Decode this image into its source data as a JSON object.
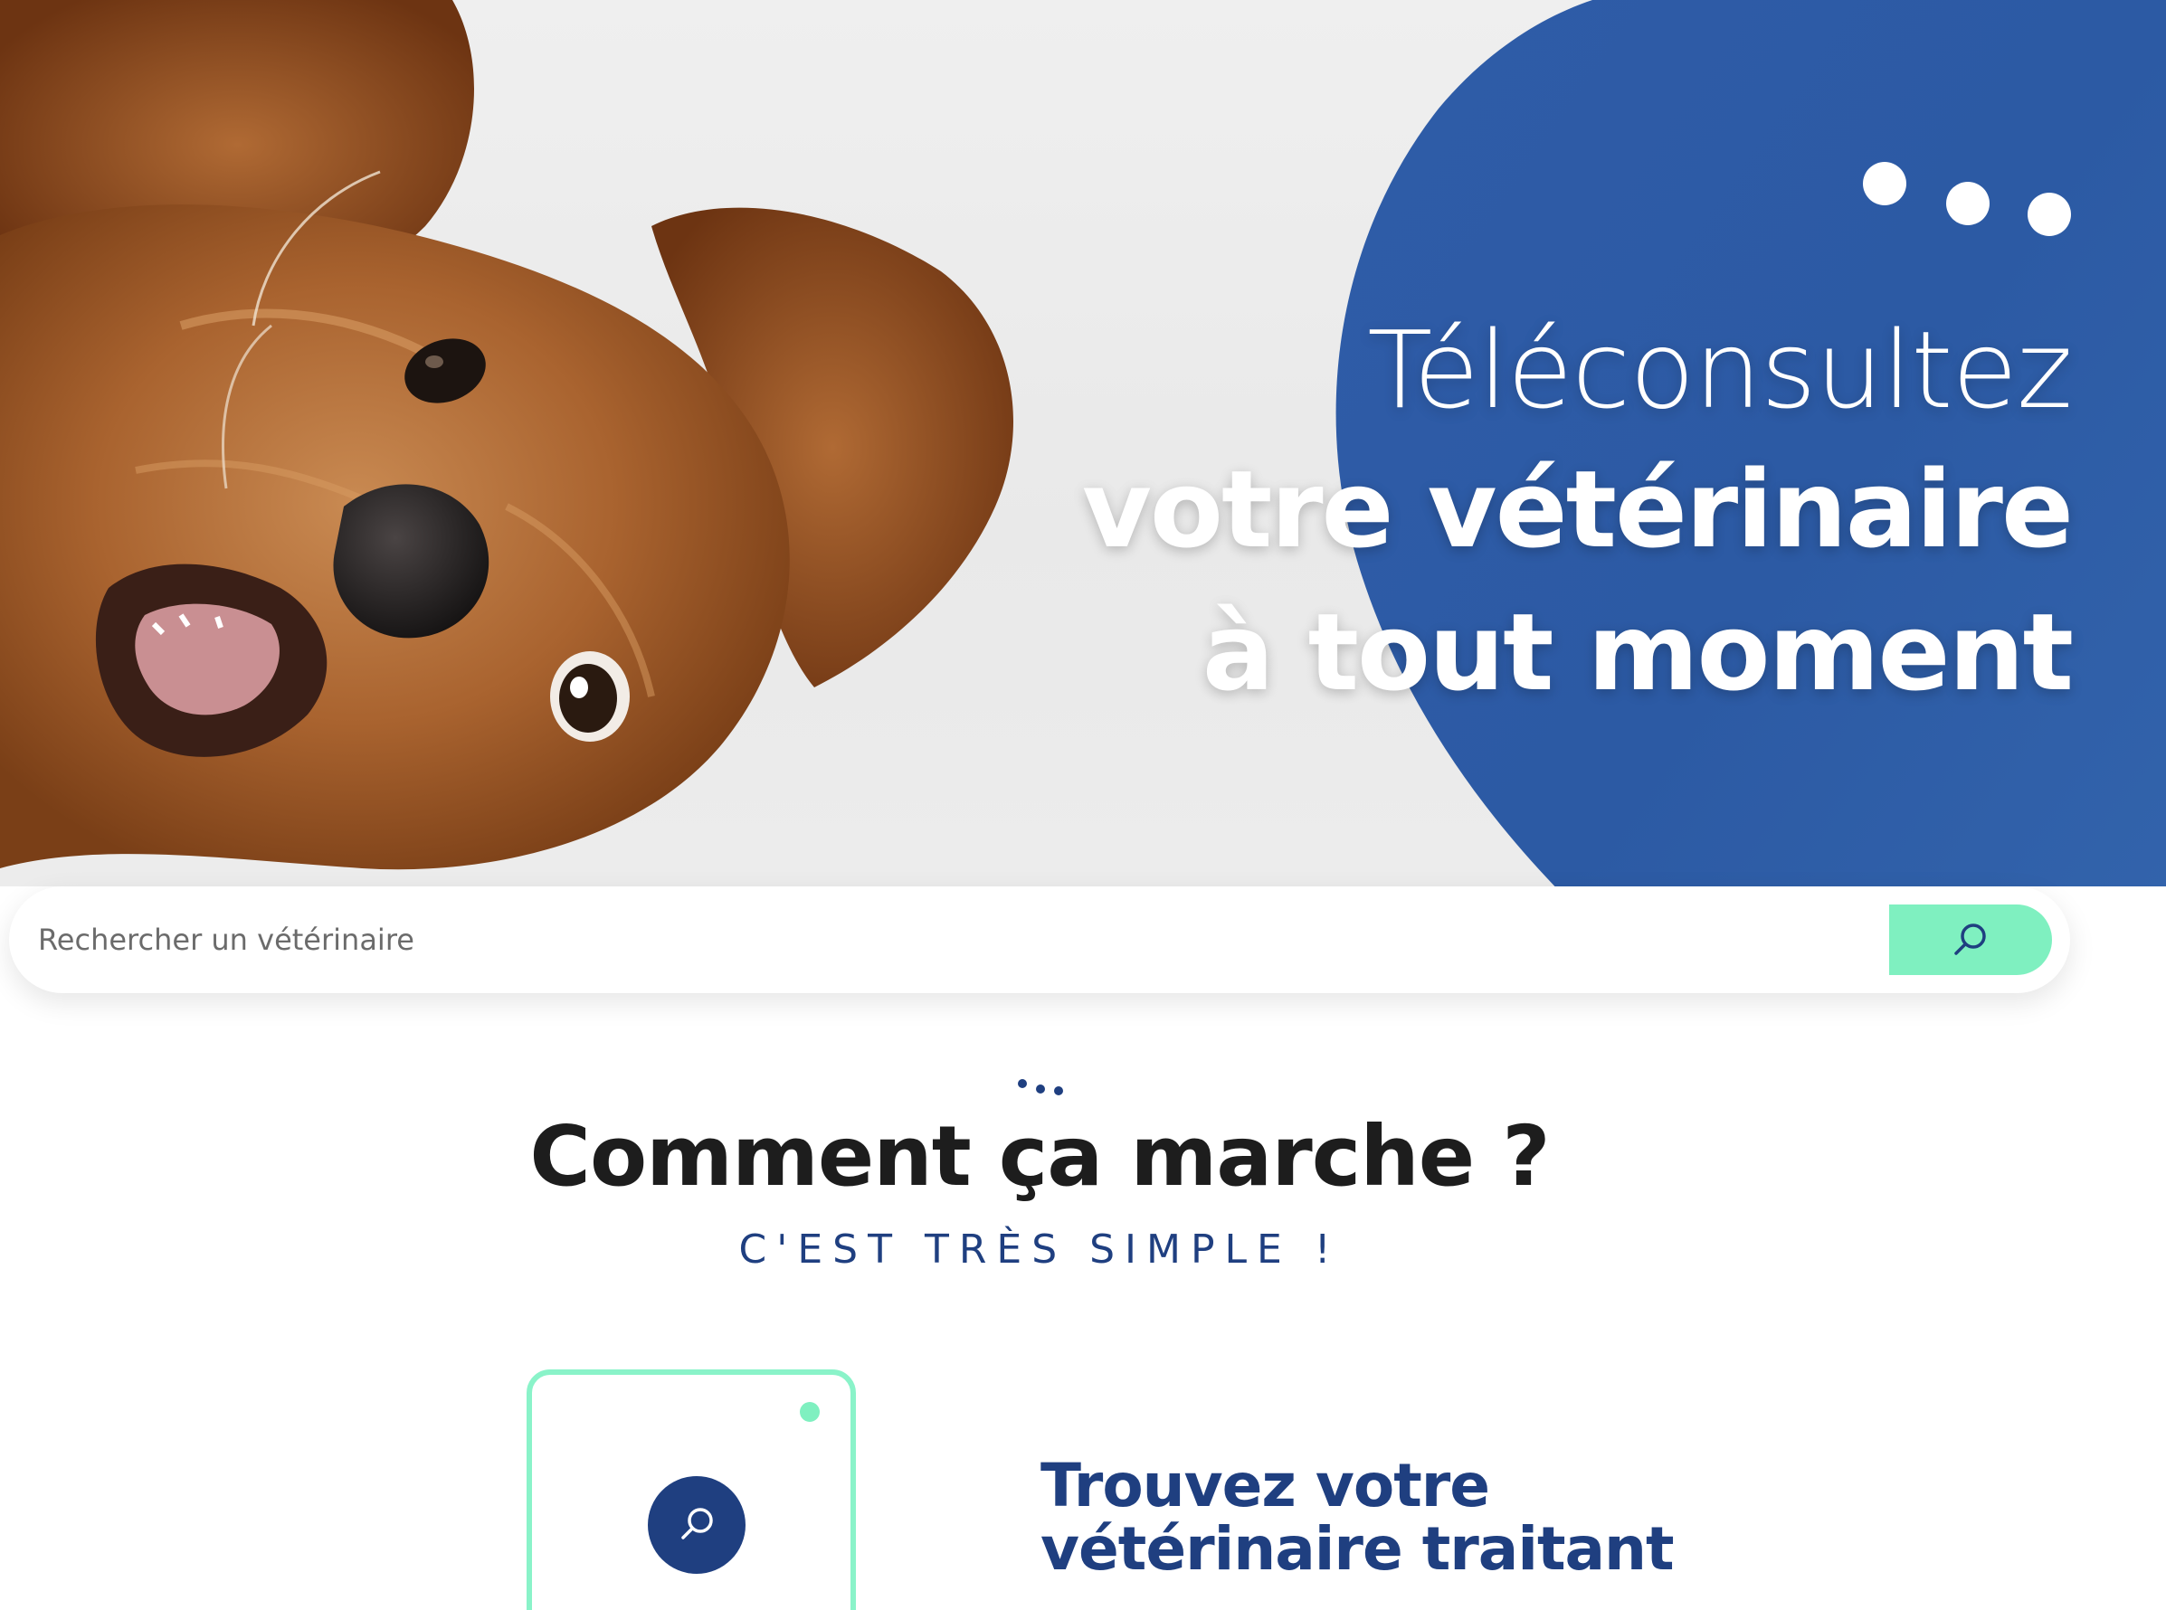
{
  "hero": {
    "title_line1": "Téléconsultez",
    "title_line2": "votre vétérinaire",
    "title_line3": "à tout moment",
    "image_subject": "dog-photo",
    "colors": {
      "blob": "#2f5ea8",
      "accent": "#7ff0c0",
      "navy": "#1f3f80"
    }
  },
  "search": {
    "placeholder": "Rechercher un vétérinaire",
    "button_icon": "search-icon"
  },
  "how_it_works": {
    "title": "Comment ça marche ?",
    "subtitle": "C'EST TRÈS SIMPLE !",
    "steps": [
      {
        "icon": "search-icon",
        "title_line1": "Trouvez votre",
        "title_line2": "vétérinaire traitant"
      }
    ]
  }
}
